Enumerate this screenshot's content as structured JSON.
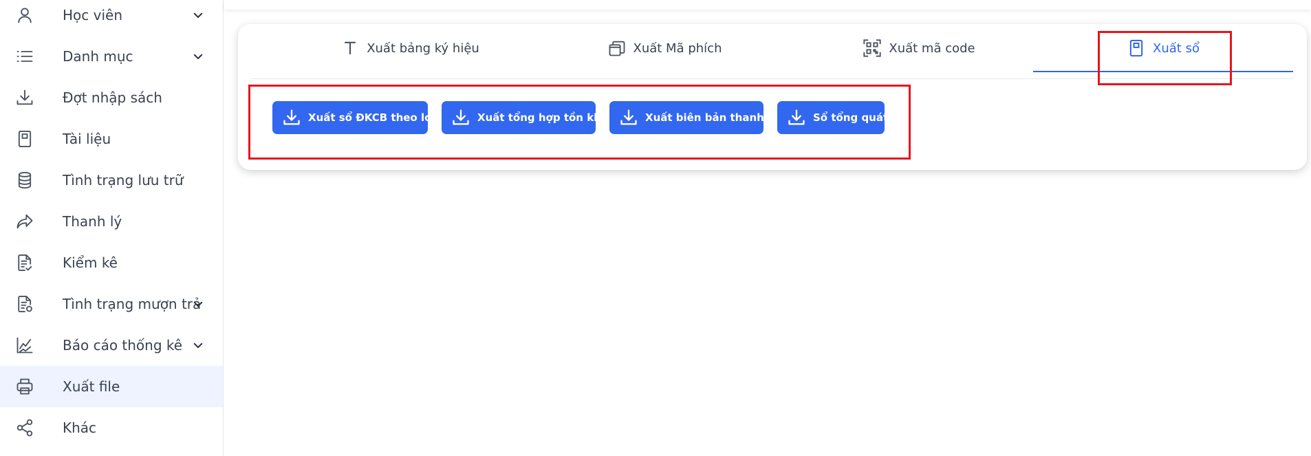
{
  "sidebar": {
    "items": [
      {
        "label": "Học viên",
        "icon": "user-icon",
        "has_chevron": true
      },
      {
        "label": "Danh mục",
        "icon": "list-icon",
        "has_chevron": true
      },
      {
        "label": "Đợt nhập sách",
        "icon": "download-icon",
        "has_chevron": false
      },
      {
        "label": "Tài liệu",
        "icon": "book-icon",
        "has_chevron": false
      },
      {
        "label": "Tình trạng lưu trữ",
        "icon": "database-icon",
        "has_chevron": false
      },
      {
        "label": "Thanh lý",
        "icon": "share-arrow-icon",
        "has_chevron": false
      },
      {
        "label": "Kiểm kê",
        "icon": "checklist-icon",
        "has_chevron": false
      },
      {
        "label": "Tình trạng mượn trả",
        "icon": "document-refresh-icon",
        "has_chevron": true
      },
      {
        "label": "Báo cáo thống kê",
        "icon": "line-chart-icon",
        "has_chevron": true
      },
      {
        "label": "Xuất file",
        "icon": "printer-icon",
        "has_chevron": false,
        "active": true
      },
      {
        "label": "Khác",
        "icon": "share-nodes-icon",
        "has_chevron": false
      }
    ]
  },
  "tabs": [
    {
      "label": "Xuất bảng ký hiệu",
      "icon": "text-icon"
    },
    {
      "label": "Xuất Mã phích",
      "icon": "copy-icon"
    },
    {
      "label": "Xuất mã code",
      "icon": "qrcode-icon"
    },
    {
      "label": "Xuất sổ",
      "icon": "book-icon",
      "active": true
    }
  ],
  "actions": [
    {
      "label": "Xuất sổ ĐKCB theo loại",
      "icon": "download-icon"
    },
    {
      "label": "Xuất tổng hợp tồn kho",
      "icon": "download-icon"
    },
    {
      "label": "Xuất biên bản thanh lý",
      "icon": "download-icon"
    },
    {
      "label": "Sổ tổng quát",
      "icon": "download-icon"
    }
  ],
  "colors": {
    "accent": "#2f64ec",
    "button": "#3267ef",
    "active_sidebar_bg": "#eef3ff",
    "highlight": "#e8141c"
  }
}
